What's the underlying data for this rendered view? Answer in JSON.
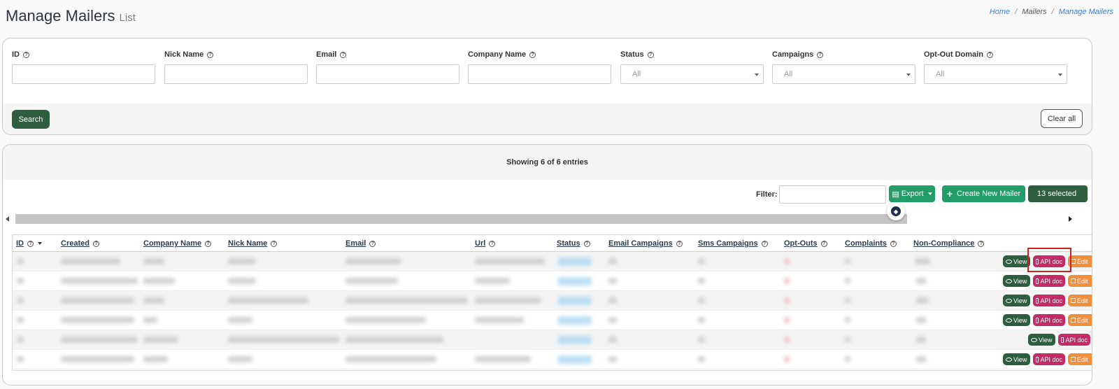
{
  "header": {
    "title": "Manage Mailers",
    "subtitle": "List",
    "breadcrumb": [
      "Home",
      "Mailers",
      "Manage Mailers"
    ]
  },
  "filters": {
    "fields": [
      {
        "label": "ID",
        "type": "text",
        "value": ""
      },
      {
        "label": "Nick Name",
        "type": "text",
        "value": ""
      },
      {
        "label": "Email",
        "type": "text",
        "value": ""
      },
      {
        "label": "Company Name",
        "type": "text",
        "value": ""
      },
      {
        "label": "Status",
        "type": "select",
        "value": "All"
      },
      {
        "label": "Campaigns",
        "type": "select",
        "value": "All"
      },
      {
        "label": "Opt-Out Domain",
        "type": "select",
        "value": "All"
      }
    ],
    "search_label": "Search",
    "clear_label": "Clear all"
  },
  "list": {
    "showing_text": "Showing 6 of 6 entries",
    "filter_label": "Filter:",
    "filter_value": "",
    "export_label": "Export",
    "create_label": "Create New Mailer",
    "selected_label": "13 selected",
    "columns": [
      "ID",
      "Created",
      "Company Name",
      "Nick Name",
      "Email",
      "Url",
      "Status",
      "Email Campaigns",
      "Sms Campaigns",
      "Opt-Outs",
      "Complaints",
      "Non-Compliance"
    ],
    "actions": {
      "view": "View",
      "api_doc": "API doc",
      "edit": "Edit"
    }
  },
  "colors": {
    "primary_dark": "#2f5d3f",
    "accent_green": "#229d6a",
    "api_pink": "#c22b66",
    "edit_orange": "#f08f3d",
    "highlight_red": "#d31f1f"
  }
}
